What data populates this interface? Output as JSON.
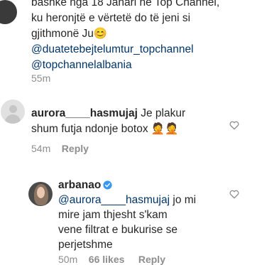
{
  "first_comment": {
    "lines": [
      "bashke nga 18 Janari ne Top Channel,",
      "ku heronjtë e vërtetë do të jeni si",
      "gjithmonë Ju"
    ],
    "emoji": "😊",
    "mentions": [
      "@duatetebejtelumtur_topchannel",
      "@topchannelalbania"
    ],
    "time": "55m"
  },
  "comment_aurora": {
    "username": "aurora____hasmujaj",
    "text_line1": "Je plakur",
    "text_line2": "shum futja ndonje botox",
    "emojis": "🤦🤦",
    "time": "54m",
    "reply_label": "Reply"
  },
  "reply_arban": {
    "username": "arbanao",
    "mention": "@aurora____hasmujaj",
    "text_line1": " jo mi",
    "text_line2": "mire jam thjesht s'kam",
    "text_line3": "vene filtrat e bukurise se",
    "text_line4": "perjetshme",
    "time": "50m",
    "likes": "66 likes",
    "reply_label": "Reply"
  },
  "icons": {
    "heart": "heart-outline-icon",
    "verified": "verified-badge-icon",
    "avatar_placeholder": "default-avatar-icon"
  },
  "colors": {
    "link": "#003569",
    "meta": "#8e8e8e",
    "verified": "#3897f0"
  }
}
